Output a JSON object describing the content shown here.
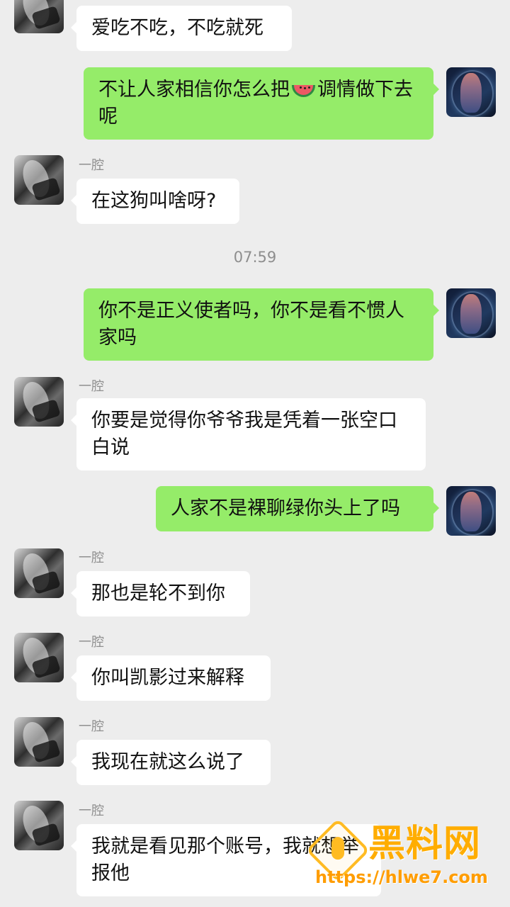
{
  "chat": {
    "timestamp": "07:59",
    "messages": [
      {
        "sender_name": "",
        "text": "爱吃不吃，不吃就死"
      },
      {
        "sender_name": "",
        "text_before_emoji": "不让人家相信你怎么把",
        "emoji": "watermelon-icon",
        "text_after_emoji": "调情做下去呢"
      },
      {
        "sender_name": "一腔",
        "text": "在这狗叫啥呀?"
      },
      {
        "sender_name": "",
        "text": "你不是正义使者吗，你不是看不惯人家吗"
      },
      {
        "sender_name": "一腔",
        "text": "你要是觉得你爷爷我是凭着一张空口白说"
      },
      {
        "sender_name": "",
        "text": "人家不是裸聊绿你头上了吗"
      },
      {
        "sender_name": "一腔",
        "text": "那也是轮不到你"
      },
      {
        "sender_name": "一腔",
        "text": "你叫凯影过来解释"
      },
      {
        "sender_name": "一腔",
        "text": "我现在就这么说了"
      },
      {
        "sender_name": "一腔",
        "text": "我就是看见那个账号，我就想举报他"
      }
    ]
  },
  "watermark": {
    "brand": "黑料网",
    "url": "https://hlwe7.com",
    "icon": "watermark-logo-icon"
  }
}
